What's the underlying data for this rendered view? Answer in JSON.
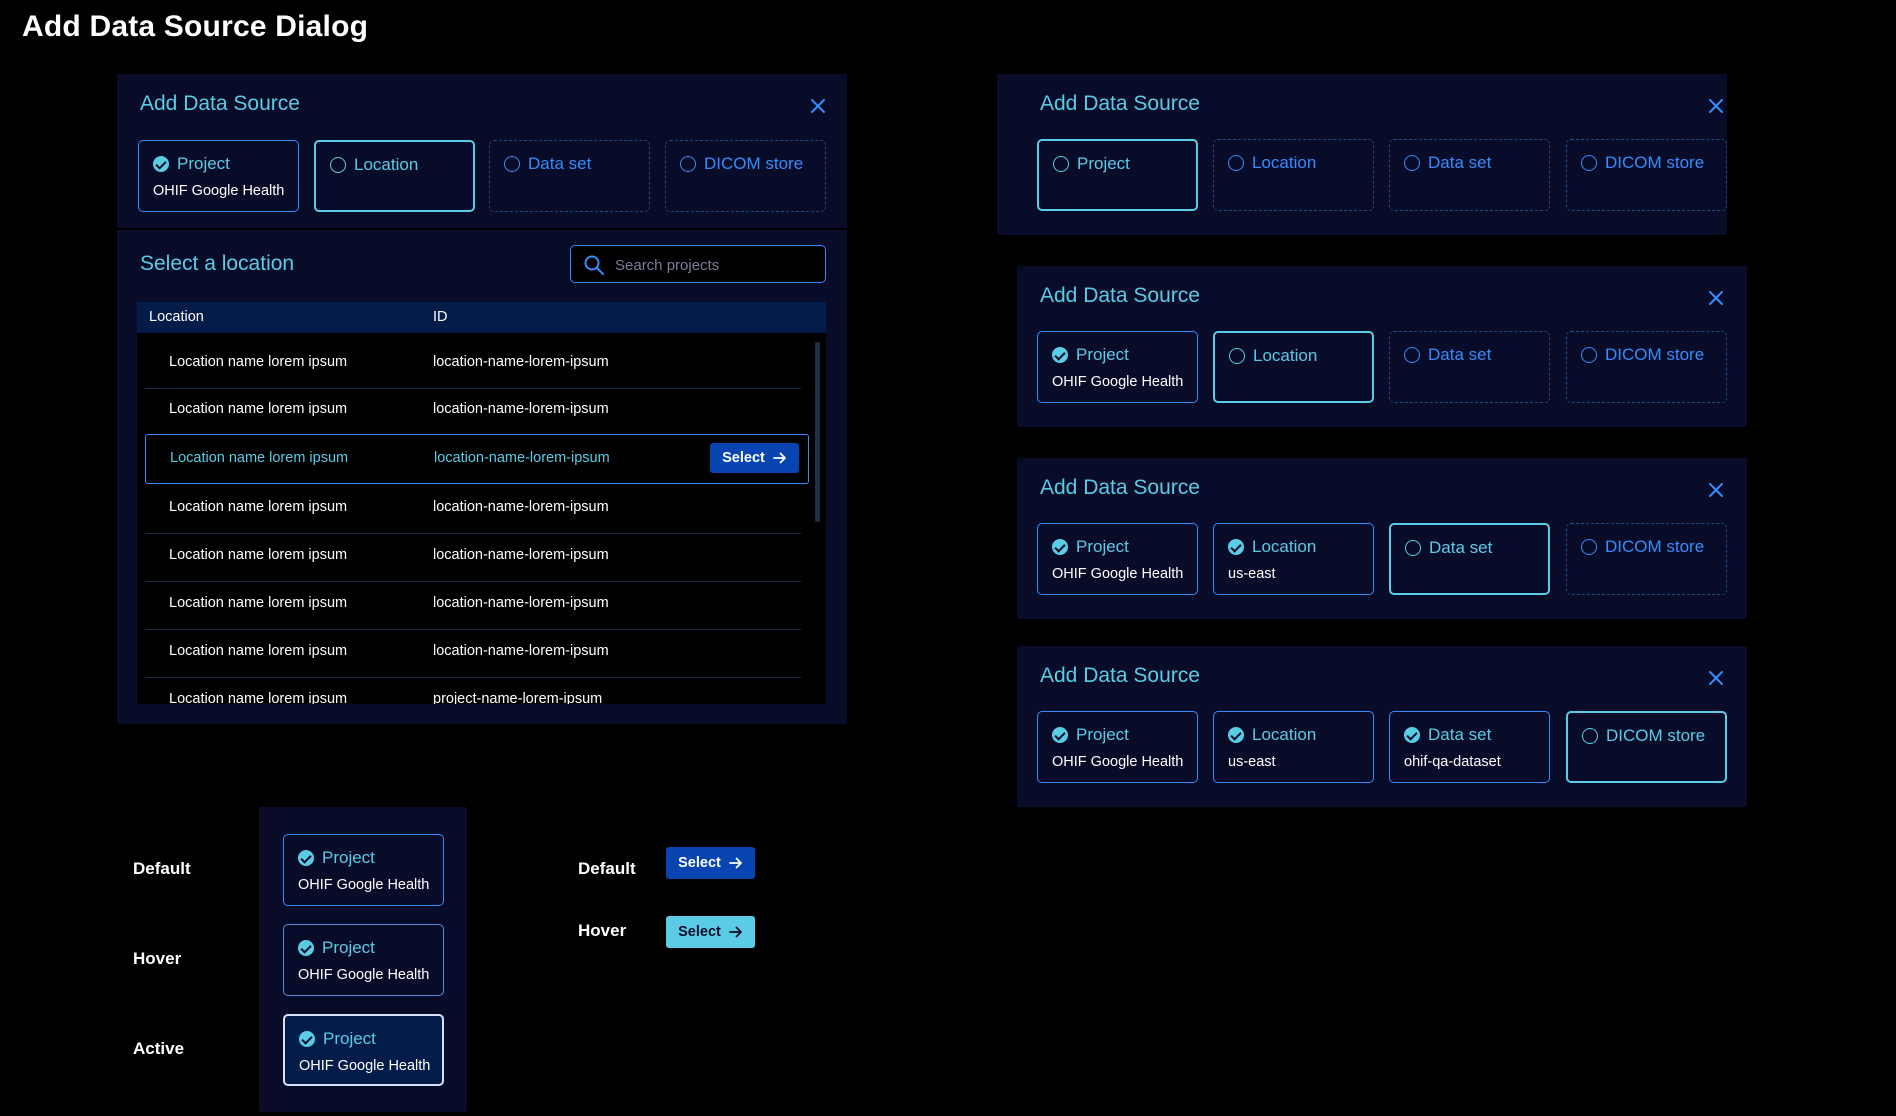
{
  "page": {
    "title": "Add Data Source Dialog"
  },
  "dialog": {
    "title": "Add Data Source",
    "steps": {
      "project": "Project",
      "location": "Location",
      "dataset": "Data set",
      "dicom": "DICOM store"
    },
    "values": {
      "project": "OHIF Google Health",
      "location": "us-east",
      "dataset": "ohif-qa-dataset"
    },
    "select_location_title": "Select a location",
    "search_placeholder": "Search projects",
    "table": {
      "headers": {
        "location": "Location",
        "id": "ID"
      },
      "rows": [
        {
          "name": "Location name lorem ipsum",
          "id": "location-name-lorem-ipsum"
        },
        {
          "name": "Location name lorem ipsum",
          "id": "location-name-lorem-ipsum"
        },
        {
          "name": "Location name lorem ipsum",
          "id": "location-name-lorem-ipsum"
        },
        {
          "name": "Location name lorem ipsum",
          "id": "location-name-lorem-ipsum"
        },
        {
          "name": "Location name lorem ipsum",
          "id": "location-name-lorem-ipsum"
        },
        {
          "name": "Location name lorem ipsum",
          "id": "location-name-lorem-ipsum"
        },
        {
          "name": "Location name lorem ipsum",
          "id": "location-name-lorem-ipsum"
        },
        {
          "name": "Location name lorem ipsum",
          "id": "project-name-lorem-ipsum"
        }
      ],
      "highlighted_row": 3,
      "select_label": "Select"
    }
  },
  "states": {
    "default": "Default",
    "hover": "Hover",
    "active": "Active"
  },
  "colors": {
    "background": "#000000",
    "panel": "#090c29",
    "accent_cyan": "#5acce6",
    "accent_blue": "#348cfd",
    "button_blue": "#0944b3",
    "table_header": "#041c4a"
  },
  "icons": {
    "close": "close-icon",
    "check": "check-circle-icon",
    "radio": "radio-empty-icon",
    "search": "search-icon",
    "arrow": "arrow-right-icon"
  }
}
